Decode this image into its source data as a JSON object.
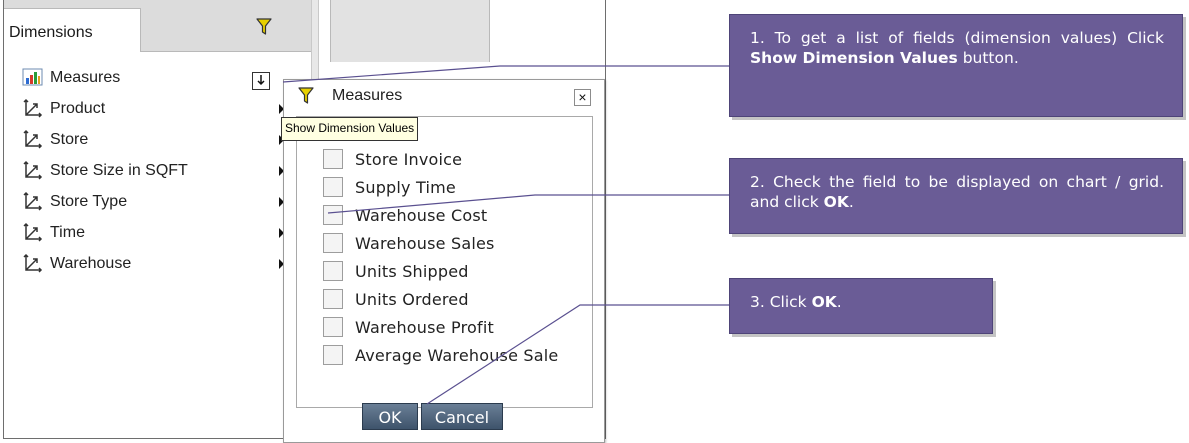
{
  "dimensions_panel": {
    "tab_label": "Dimensions",
    "filter_icon": "filter-funnel-icon",
    "tree": [
      {
        "label": "Measures",
        "icon": "bar-chart-icon"
      },
      {
        "label": "Product",
        "icon": "dimension-icon"
      },
      {
        "label": "Store",
        "icon": "dimension-icon"
      },
      {
        "label": "Store Size in SQFT",
        "icon": "dimension-icon"
      },
      {
        "label": "Store Type",
        "icon": "dimension-icon"
      },
      {
        "label": "Time",
        "icon": "dimension-icon"
      },
      {
        "label": "Warehouse",
        "icon": "dimension-icon"
      }
    ]
  },
  "tooltip": "Show Dimension Values",
  "popup": {
    "title": "Measures",
    "close_label": "×",
    "items": [
      {
        "label": "Store Invoice",
        "checked": false
      },
      {
        "label": "Supply Time",
        "checked": false
      },
      {
        "label": "Warehouse Cost",
        "checked": false
      },
      {
        "label": "Warehouse Sales",
        "checked": false
      },
      {
        "label": "Units Shipped",
        "checked": false
      },
      {
        "label": "Units Ordered",
        "checked": false
      },
      {
        "label": "Warehouse Profit",
        "checked": false
      },
      {
        "label": "Average Warehouse Sale",
        "checked": false
      }
    ],
    "ok_label": "OK",
    "cancel_label": "Cancel"
  },
  "callouts": {
    "c1_pre": "1. To get a list of fields (dimension values) Click ",
    "c1_bold": "Show Dimension Values",
    "c1_post": " button.",
    "c2_pre": "2. Check the field to be displayed on chart / grid.  and click ",
    "c2_bold": "OK",
    "c2_post": ".",
    "c3_pre": "3. Click ",
    "c3_bold": "OK",
    "c3_post": "."
  },
  "colors": {
    "callout_bg": "#6a5c96",
    "button_bg": "#4e6580",
    "tooltip_bg": "#ffffe1"
  }
}
